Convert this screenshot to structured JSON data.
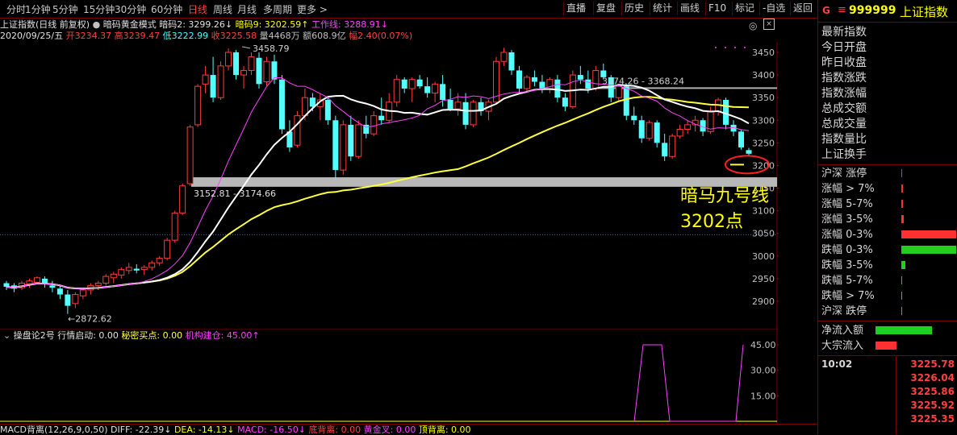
{
  "toolbar": {
    "left": [
      "分时",
      "1分钟",
      "5分钟",
      "15分钟",
      "30分钟",
      "60分钟",
      "日线",
      "周线",
      "月线",
      "多周期",
      "更多 >"
    ],
    "active": "日线",
    "right": [
      "直播",
      "复盘",
      "历史",
      "统计",
      "画线",
      "F10",
      "标记",
      "-自选",
      "返回"
    ]
  },
  "info1": {
    "index_name": "上证指数(日线 前复权)",
    "indicator": "暗码黄金模式",
    "code2": "暗码2: 3299.26↓",
    "code9": "暗码9: 3202.59↑",
    "workline": "工作线: 3288.91↓"
  },
  "info2": {
    "date": "2020/09/25/五",
    "open": "开3234.37",
    "high": "高3239.47",
    "low": "低3222.99",
    "close": "收3225.58",
    "volume": "量4468万",
    "amount": "额608.9亿",
    "change": "幅2.40(0.07%)"
  },
  "chart_data": {
    "type": "line",
    "title": "上证指数(日线 前复权)",
    "y_axis": {
      "ticks": [
        3450,
        3400,
        3350,
        3300,
        3250,
        3200,
        3150,
        3100,
        3050,
        3000,
        2950,
        2900
      ]
    },
    "annotations": {
      "high": "3458.79",
      "low": "←2872.62",
      "resistance": "3374.26 - 3368.24",
      "support": "3152.81 - 3174.66",
      "note_line1": "暗马九号线",
      "note_line2": "3202点"
    },
    "sub_chart": {
      "title": "操盘论2号",
      "items": [
        "行情启动: 0.00",
        "秘密买点: 0.00",
        "机构建仓: 45.00↑"
      ],
      "y_ticks": [
        "45.00",
        "30.00",
        "15.00"
      ]
    }
  },
  "bottom": {
    "macd": "MACD背离(12,26,9,0,50)",
    "diff": "DIFF: -22.39↓",
    "dea": "DEA: -14.13↓",
    "macd_val": "MACD: -16.50↓",
    "bottom_div": "底背离: 0.00",
    "golden": "黄金叉: 0.00",
    "top_div": "顶背离: 0.00"
  },
  "right": {
    "code": "999999",
    "name": "上证指数",
    "labels": [
      "最新指数",
      "今日开盘",
      "昨日收盘",
      "指数涨跌",
      "指数涨幅",
      "总成交额",
      "总成交量",
      "指数量比",
      "上证换手"
    ],
    "breadth": [
      {
        "label": "沪深 涨停",
        "color": "#ff3030",
        "width": 1
      },
      {
        "label": "涨幅 > 7%",
        "color": "#ff3030",
        "width": 2
      },
      {
        "label": "涨幅 5-7%",
        "color": "#ff3030",
        "width": 2
      },
      {
        "label": "涨幅 3-5%",
        "color": "#ff3030",
        "width": 3
      },
      {
        "label": "涨幅 0-3%",
        "color": "#ff3030",
        "width": 68
      },
      {
        "label": "跌幅 0-3%",
        "color": "#20d020",
        "width": 68
      },
      {
        "label": "跌幅 3-5%",
        "color": "#20d020",
        "width": 5
      },
      {
        "label": "跌幅 5-7%",
        "color": "#20d020",
        "width": 1
      },
      {
        "label": "跌幅 > 7%",
        "color": "#20d020",
        "width": 1
      },
      {
        "label": "沪深 跌停",
        "color": "#20d020",
        "width": 1
      }
    ],
    "flows": [
      {
        "label": "净流入额",
        "color": "#20d020",
        "width": 70
      },
      {
        "label": "大宗流入",
        "color": "#ff3030",
        "width": 26
      }
    ],
    "ticks": {
      "time": "10:02",
      "prices": [
        "3225.78",
        "3226.04",
        "3225.86",
        "3225.92",
        "3225.35"
      ]
    }
  }
}
